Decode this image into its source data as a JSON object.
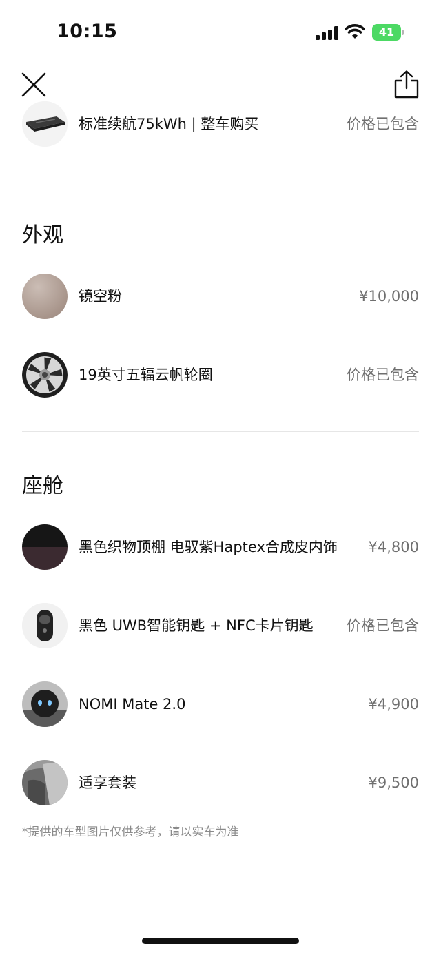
{
  "status_bar": {
    "time": "10:15",
    "battery_level": "41",
    "battery_color": "#4cd964"
  },
  "nav": {
    "close_icon": "close-icon",
    "share_icon": "share-icon"
  },
  "battery_option": {
    "label": "标准续航75kWh | 整车购买",
    "price": "价格已包含"
  },
  "exterior": {
    "title": "外观",
    "items": [
      {
        "label": "镜空粉",
        "price": "¥10,000",
        "swatch_color": "#b7a59c"
      },
      {
        "label": "19英寸五辐云帆轮圈",
        "price": "价格已包含"
      }
    ]
  },
  "cabin": {
    "title": "座舱",
    "items": [
      {
        "label": "黑色织物顶棚 电驭紫Haptex合成皮内饰",
        "price": "¥4,800"
      },
      {
        "label": "黑色 UWB智能钥匙 + NFC卡片钥匙",
        "price": "价格已包含"
      },
      {
        "label": "NOMI Mate 2.0",
        "price": "¥4,900"
      },
      {
        "label": "适享套装",
        "price": "¥9,500"
      }
    ]
  },
  "footnote": "*提供的车型图片仅供参考，请以实车为准"
}
